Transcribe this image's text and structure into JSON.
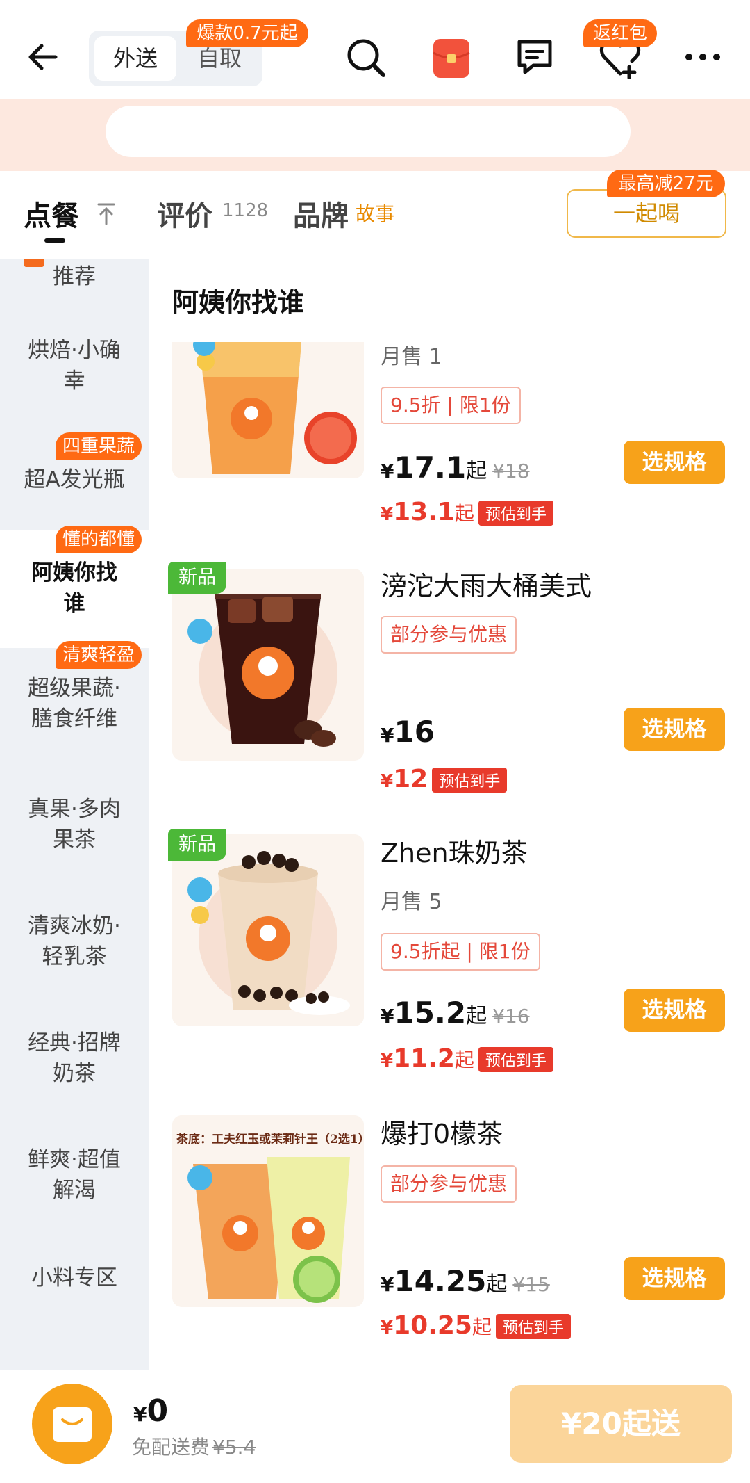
{
  "header": {
    "mode_delivery": "外送",
    "mode_pickup": "自取",
    "pickup_badge": "爆款0.7元起",
    "heart_badge": "返红包"
  },
  "tabs": {
    "order": "点餐",
    "review": "评价",
    "review_count": "1128",
    "brand": "品牌",
    "brand_story": "故事",
    "group_button": "一起喝",
    "group_badge": "最高减27元"
  },
  "sidebar": {
    "items": [
      {
        "label": "推荐"
      },
      {
        "label": "烘焙·小确\n幸"
      },
      {
        "label": "超A发光瓶",
        "tag": "四重果蔬"
      },
      {
        "label": "阿姨你找\n谁",
        "tag": "懂的都懂"
      },
      {
        "label": "超级果蔬·\n膳食纤维",
        "tag": "清爽轻盈"
      },
      {
        "label": "真果·多肉\n果茶"
      },
      {
        "label": "清爽冰奶·\n轻乳茶"
      },
      {
        "label": "经典·招牌\n奶茶"
      },
      {
        "label": "鲜爽·超值\n解渴"
      },
      {
        "label": "小料专区"
      }
    ]
  },
  "section_title": "阿姨你找谁",
  "products": [
    {
      "name": "",
      "sold": "月售 1",
      "promo": "9.5折 | 限1份",
      "currency": "¥",
      "price": "17.1",
      "price_suffix": "起",
      "original_price": "¥18",
      "est_price": "13.1",
      "est_suffix": "起",
      "est_tag": "预估到手",
      "button": "选规格"
    },
    {
      "name": "滂沱大雨大桶美式",
      "sold": "",
      "promo": "部分参与优惠",
      "new_tag": "新品",
      "currency": "¥",
      "price": "16",
      "price_suffix": "",
      "original_price": "",
      "est_price": "12",
      "est_suffix": "",
      "est_tag": "预估到手",
      "button": "选规格"
    },
    {
      "name": "Zhen珠奶茶",
      "sold": "月售 5",
      "promo": "9.5折起 | 限1份",
      "new_tag": "新品",
      "currency": "¥",
      "price": "15.2",
      "price_suffix": "起",
      "original_price": "¥16",
      "est_price": "11.2",
      "est_suffix": "起",
      "est_tag": "预估到手",
      "button": "选规格"
    },
    {
      "name": "爆打0檬茶",
      "sold": "",
      "promo": "部分参与优惠",
      "image_caption": "茶底：工夫红玉或茉莉针王（2选1）",
      "currency": "¥",
      "price": "14.25",
      "price_suffix": "起",
      "original_price": "¥15",
      "est_price": "10.25",
      "est_suffix": "起",
      "est_tag": "预估到手",
      "button": "选规格"
    }
  ],
  "cart": {
    "currency": "¥",
    "total": "0",
    "delivery_fee_label": "免配送费",
    "delivery_fee_original": "¥5.4",
    "min_order": "¥20起送"
  },
  "colors": {
    "accent_orange": "#f7a21a",
    "badge_orange": "#ff6a13",
    "price_red": "#e83a2b",
    "new_green": "#4cb838"
  },
  "icons": [
    "back-arrow-icon",
    "search-icon",
    "red-packet-icon",
    "chat-icon",
    "heart-plus-icon",
    "more-icon",
    "cart-bag-icon",
    "cold-icon",
    "hot-icon"
  ]
}
